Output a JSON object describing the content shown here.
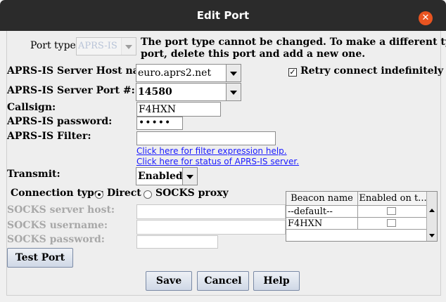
{
  "window": {
    "title": "Edit Port",
    "close_glyph": "✕"
  },
  "port_type": {
    "label": "Port type",
    "value": "APRS-IS",
    "note_line1": "The port type cannot be changed. To make a different type",
    "note_line2": "port, delete this port and add a new one."
  },
  "server_host": {
    "label": "APRS-IS Server Host name:",
    "value": "euro.aprs2.net"
  },
  "retry": {
    "label": "Retry connect indefinitely",
    "checked": true,
    "check_glyph": "✓"
  },
  "server_port": {
    "label": "APRS-IS Server Port #:",
    "value": "14580"
  },
  "callsign": {
    "label": "Callsign:",
    "value": "F4HXN"
  },
  "password": {
    "label": "APRS-IS password:",
    "value": "•••••"
  },
  "filter": {
    "label": "APRS-IS Filter:",
    "value": "",
    "help_link": "Click here for filter expression help.",
    "status_link": "Click here for status of APRS-IS server."
  },
  "transmit": {
    "label": "Transmit:",
    "value": "Enabled"
  },
  "connection": {
    "label": "Connection type:",
    "options": [
      "Direct",
      "SOCKS proxy"
    ],
    "selected": "Direct"
  },
  "socks": {
    "host_label": "SOCKS server host:",
    "username_label": "SOCKS username:",
    "password_label": "SOCKS password:",
    "host_value": "",
    "username_value": "",
    "password_value": ""
  },
  "beacon_table": {
    "columns": [
      "Beacon name",
      "Enabled on t..."
    ],
    "rows": [
      {
        "name": "--default--",
        "enabled": false
      },
      {
        "name": "F4HXN",
        "enabled": false
      }
    ]
  },
  "buttons": {
    "test_port": "Test Port",
    "save": "Save",
    "cancel": "Cancel",
    "help": "Help"
  },
  "colors": {
    "titlebar": "#2b2b2b",
    "close": "#e95420",
    "link": "#1a1aff"
  }
}
